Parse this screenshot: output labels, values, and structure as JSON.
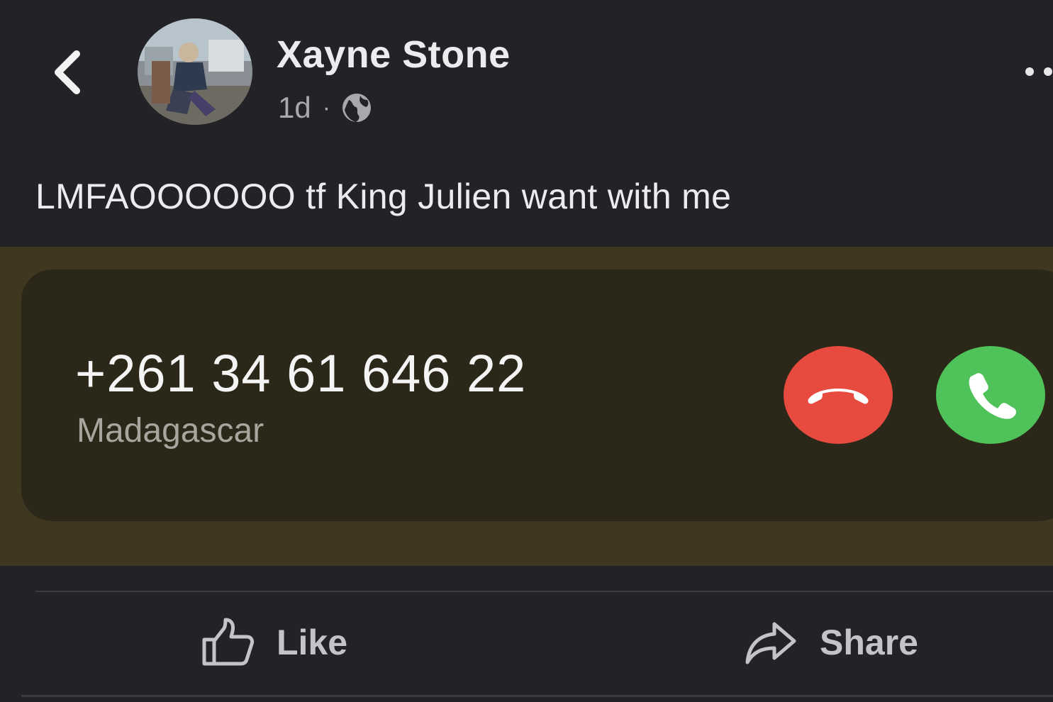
{
  "post": {
    "author_name": "Xayne Stone",
    "time_ago": "1d",
    "separator": "·",
    "privacy_icon": "globe-icon",
    "text": "LMFAOOOOOO tf King Julien want with me"
  },
  "call_screenshot": {
    "phone_number": "+261 34 61 646 22",
    "location": "Madagascar",
    "decline_icon": "phone-hangup-icon",
    "accept_icon": "phone-icon",
    "colors": {
      "decline": "#e74a3f",
      "accept": "#4fc35a"
    }
  },
  "actions": {
    "like_label": "Like",
    "share_label": "Share"
  },
  "icons": {
    "back": "chevron-left-icon",
    "more": "more-dots-icon",
    "like": "thumbs-up-icon",
    "share": "share-arrow-icon"
  }
}
